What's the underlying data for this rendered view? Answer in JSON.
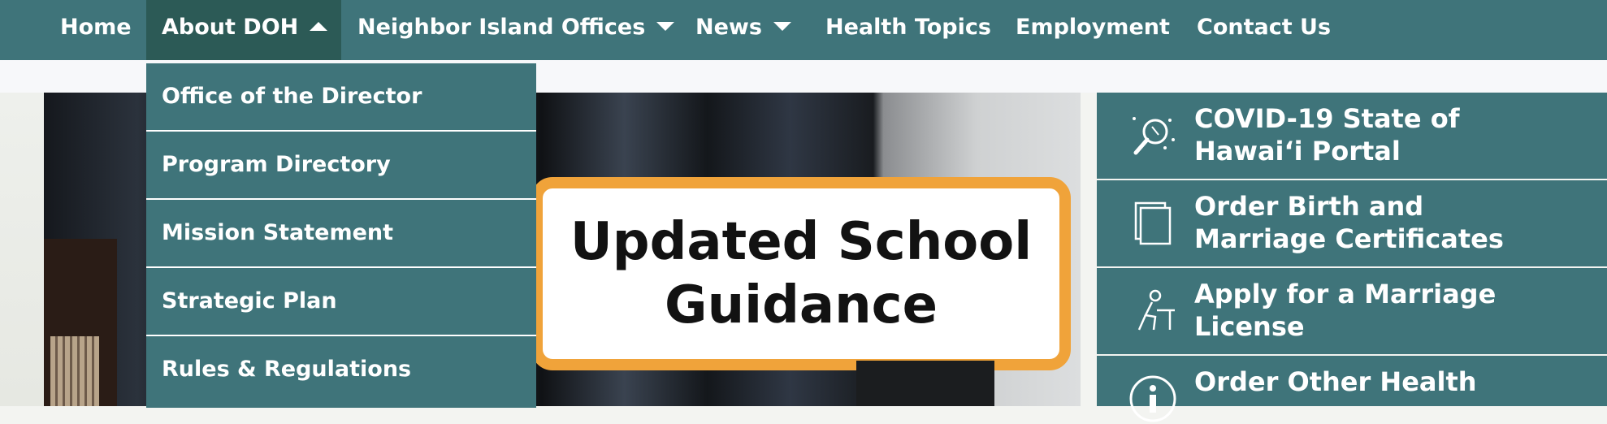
{
  "nav": {
    "items": [
      {
        "label": "Home"
      },
      {
        "label": "About DOH"
      },
      {
        "label": "Neighbor Island Offices"
      },
      {
        "label": "News"
      },
      {
        "label": "Health Topics"
      },
      {
        "label": "Employment"
      },
      {
        "label": "Contact Us"
      }
    ]
  },
  "dropdown": {
    "items": [
      {
        "label": "Office of the Director"
      },
      {
        "label": "Program Directory"
      },
      {
        "label": "Mission Statement"
      },
      {
        "label": "Strategic Plan"
      },
      {
        "label": "Rules & Regulations"
      }
    ]
  },
  "hero": {
    "title_line1": "Updated School",
    "title_line2": "Guidance"
  },
  "quick_links": [
    {
      "line1": "COVID-19 State of",
      "line2": "Hawai‘i Portal",
      "icon": "virus-magnifier-icon"
    },
    {
      "line1": "Order Birth and",
      "line2": "Marriage Certificates",
      "icon": "documents-icon"
    },
    {
      "line1": "Apply for a Marriage",
      "line2": "License",
      "icon": "person-at-desk-icon"
    },
    {
      "line1": "Order Other Health",
      "line2": "",
      "icon": "info-icon"
    }
  ],
  "colors": {
    "teal": "#3f747a",
    "teal_dark": "#2c5a56",
    "accent_orange": "#f0a33a"
  }
}
